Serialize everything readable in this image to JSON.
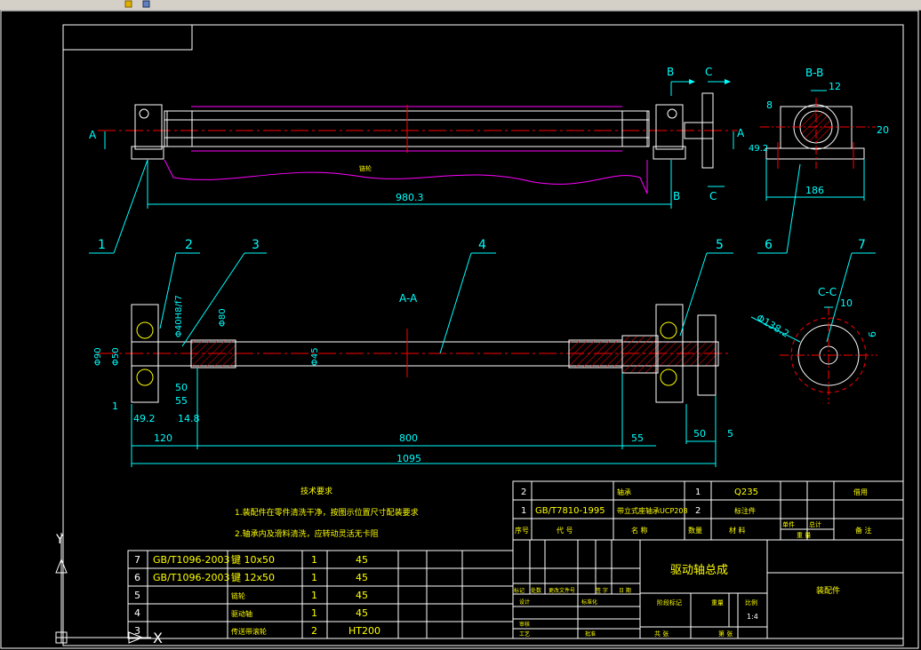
{
  "toolbar": {
    "icons": [
      "pencil-icon",
      "layers-icon"
    ]
  },
  "top_view": {
    "section_a": "A",
    "section_b": "B",
    "section_c": "C",
    "overall_length": "980.3",
    "sprocket_label": "链轮"
  },
  "section_bb": {
    "title": "B-B",
    "dim_12": "12",
    "dim_8": "8",
    "dim_20": "20",
    "dim_49_2": "49.2",
    "dim_186": "186"
  },
  "section_aa": {
    "title": "A-A",
    "dim_90": "Φ90",
    "dim_50": "Φ50",
    "dim_40h8": "Φ40H8/f7",
    "dim_80": "Φ80",
    "dim_45": "Φ45",
    "dim_50b": "50",
    "dim_55": "55",
    "dim_1": "1",
    "dim_49_2": "49.2",
    "dim_14_8": "14.8",
    "dim_120": "120",
    "dim_800": "800",
    "dim_55b": "55",
    "dim_50c": "50",
    "dim_5": "5",
    "dim_1095": "1095"
  },
  "section_cc": {
    "title": "C-C",
    "dim_10": "10",
    "dim_6": "6",
    "dim_138": "Φ138.2"
  },
  "balloons": [
    "1",
    "2",
    "3",
    "4",
    "5",
    "6",
    "7"
  ],
  "tech_req": {
    "title": "技术要求",
    "line1": "1.装配件在零件清洗干净，按图示位置尺寸配装要求",
    "line2": "2.轴承内及滑料清洗，应转动灵活无卡阻"
  },
  "bom": [
    {
      "no": "7",
      "std": "GB/T1096-2003",
      "name": "键 10x50",
      "qty": "1",
      "mat": "45"
    },
    {
      "no": "6",
      "std": "GB/T1096-2003",
      "name": "键 12x50",
      "qty": "1",
      "mat": "45"
    },
    {
      "no": "5",
      "std": "",
      "name": "链轮",
      "qty": "1",
      "mat": "45"
    },
    {
      "no": "4",
      "std": "",
      "name": "驱动轴",
      "qty": "1",
      "mat": "45"
    },
    {
      "no": "3",
      "std": "",
      "name": "传送带滚轮",
      "qty": "2",
      "mat": "HT200"
    }
  ],
  "bom_upper": [
    {
      "no": "2",
      "std": "",
      "name": "轴承",
      "qty": "1",
      "mat": "Q235",
      "note": "借用"
    },
    {
      "no": "1",
      "std": "GB/T7810-1995",
      "name": "带立式座轴承UCP208",
      "qty": "2",
      "mat": "标注件",
      "note": ""
    }
  ],
  "bom_header": {
    "no": "序号",
    "code": "代 号",
    "name": "名 称",
    "qty": "数量",
    "mat": "材 料",
    "single": "单件",
    "total": "总计",
    "weight": "重 量",
    "remark": "备 注"
  },
  "title_block": {
    "title": "驱动轴总成",
    "doc_type": "装配件",
    "scale_label": "比例",
    "scale": "1:4",
    "stage": "阶段标记",
    "weight": "重量",
    "sheet": "共 张",
    "page": "第 张",
    "mark": "标记",
    "count": "处数",
    "zone": "更改文件号",
    "sign": "签 字",
    "date": "日 期",
    "designer": "设计",
    "std": "标准化",
    "check": "审核",
    "craft": "工艺",
    "approve": "批准"
  },
  "ucs": {
    "x": "X",
    "y": "Y"
  },
  "colors": {
    "white": "#ffffff",
    "cyan": "#00ffff",
    "red": "#ff0000",
    "yellow": "#ffff00",
    "green": "#00ff00",
    "magenta": "#ff00ff"
  }
}
